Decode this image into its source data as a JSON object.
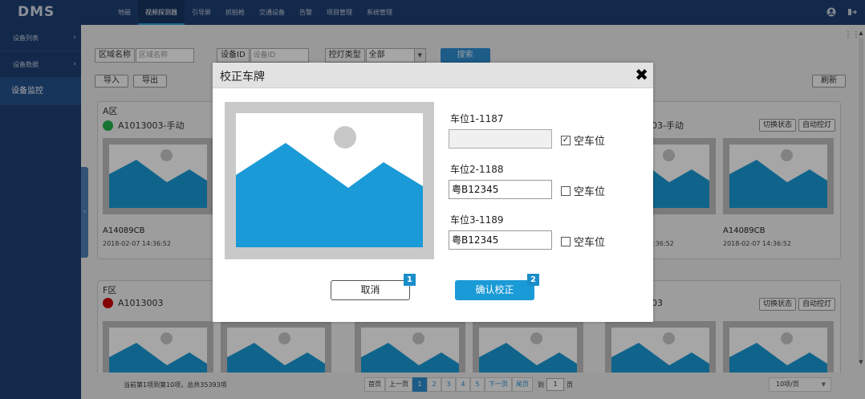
{
  "app": {
    "logo": "DMS"
  },
  "nav": {
    "items": [
      "地磁",
      "视频探测器",
      "引导屏",
      "抓拍枪",
      "交通设备",
      "告警",
      "项目管理",
      "系统管理"
    ],
    "active_index": 1
  },
  "sidebar": {
    "items": [
      {
        "label": "设备列表",
        "chev": "›"
      },
      {
        "label": "设备数据",
        "chev": "›"
      },
      {
        "label": "设备监控",
        "chev": ""
      }
    ],
    "active_index": 2
  },
  "filter": {
    "area_label": "区域名称",
    "area_placeholder": "区域名称",
    "device_label": "设备ID",
    "device_placeholder": "设备ID",
    "light_label": "控灯类型",
    "light_value": "全部",
    "search_label": "搜索"
  },
  "toolbar": {
    "import": "导入",
    "export": "导出",
    "refresh": "刷新"
  },
  "zones": [
    {
      "title": "A区",
      "status_color": "#22b14c",
      "status_text": "A1013003-手动",
      "right_status": "03-手动",
      "btn_switch": "切换状态",
      "btn_auto": "自动控灯",
      "left_plate": "A14089CB",
      "left_time": "2018-02-07 14:36:52",
      "mid_time": "36:52",
      "right_time_partial": ":36:52",
      "right_plate": "A14089CB",
      "right_time": "2018-02-07 14:36:52"
    },
    {
      "title": "F区",
      "status_color": "#cc0000",
      "status_text": "A1013003",
      "right_status": "03",
      "btn_switch": "切换状态",
      "btn_auto": "自动控灯"
    }
  ],
  "pager": {
    "info": "当前第1项到第10项，总共35393项",
    "first": "首页",
    "prev": "上一页",
    "pages": [
      "1",
      "2",
      "3",
      "4",
      "5"
    ],
    "current": "1",
    "next": "下一页",
    "last": "尾页",
    "goto_prefix": "到",
    "goto_value": "1",
    "goto_suffix": "页",
    "per_page": "10项/页"
  },
  "modal": {
    "title": "校正车牌",
    "slots": [
      {
        "label": "车位1-1187",
        "value": "",
        "empty_label": "空车位",
        "checked": true
      },
      {
        "label": "车位2-1188",
        "value": "粤B12345",
        "empty_label": "空车位",
        "checked": false
      },
      {
        "label": "车位3-1189",
        "value": "粤B12345",
        "empty_label": "空车位",
        "checked": false
      }
    ],
    "cancel": "取消",
    "confirm": "确认校正",
    "cancel_badge": "1",
    "confirm_badge": "2"
  },
  "colors": {
    "nav_bg": "#1e3f73",
    "accent": "#1a9ad6",
    "image_blue": "#1a9ad6"
  }
}
